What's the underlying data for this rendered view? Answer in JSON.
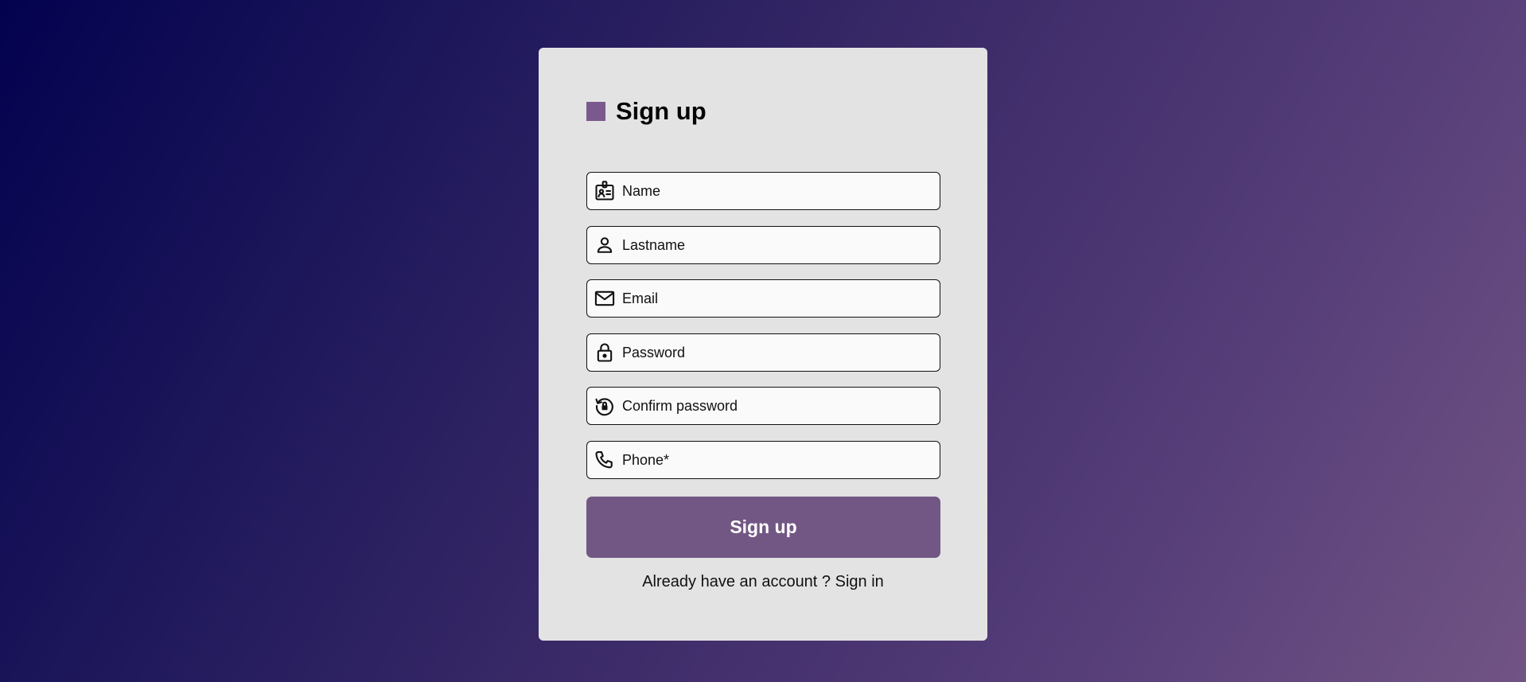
{
  "form": {
    "title": "Sign up",
    "fields": [
      {
        "placeholder": "Name",
        "value": "",
        "icon": "id-badge-icon"
      },
      {
        "placeholder": "Lastname",
        "value": "",
        "icon": "user-icon"
      },
      {
        "placeholder": "Email",
        "value": "",
        "icon": "mail-icon"
      },
      {
        "placeholder": "Password",
        "value": "",
        "icon": "lock-icon"
      },
      {
        "placeholder": "Confirm password",
        "value": "",
        "icon": "lock-reset-icon"
      },
      {
        "placeholder": "Phone*",
        "value": "",
        "icon": "phone-icon"
      }
    ],
    "submit_label": "Sign up",
    "footer_text": "Already have an account ?",
    "footer_link": "Sign in"
  },
  "colors": {
    "accent": "#725784",
    "card_background": "#e3e3e3",
    "gradient_start": "#03024f",
    "gradient_end": "#715484"
  }
}
